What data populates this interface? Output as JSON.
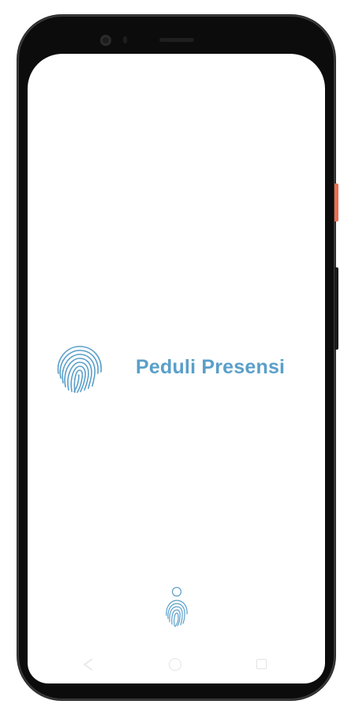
{
  "app": {
    "title": "Peduli Presensi"
  },
  "icons": {
    "splash_logo": "fingerprint-icon",
    "bottom_brand": "fingerprint-person-icon",
    "nav_back": "back-triangle-icon",
    "nav_home": "home-circle-icon",
    "nav_recents": "recents-square-icon"
  },
  "colors": {
    "brand": "#5a9fc9",
    "background": "#ffffff",
    "frame": "#0c0c0c",
    "side_button_accent": "#f26b4f"
  }
}
